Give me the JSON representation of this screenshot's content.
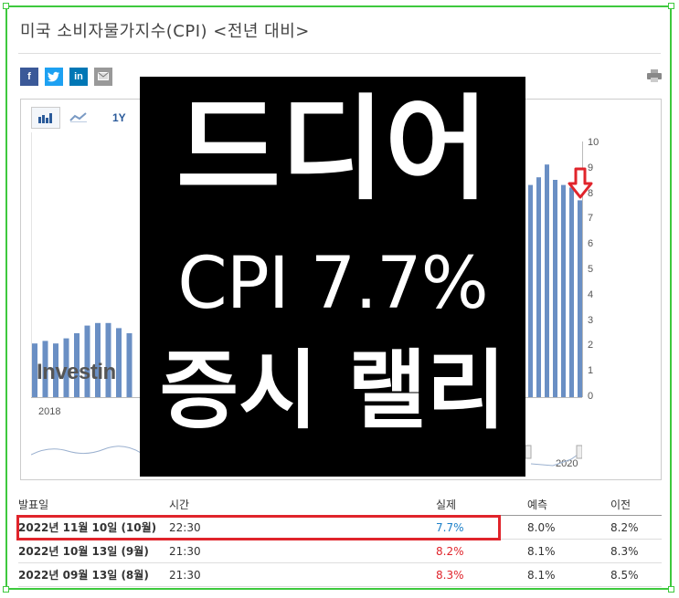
{
  "title": "미국 소비자물가지수(CPI) <전년 대비>",
  "share_buttons": [
    {
      "label": "f",
      "color": "#3b5998",
      "icon": "facebook-icon"
    },
    {
      "label": "t",
      "color": "#1da1f2",
      "icon": "twitter-icon"
    },
    {
      "label": "in",
      "color": "#0077b5",
      "icon": "linkedin-icon"
    },
    {
      "label": "",
      "color": "#999999",
      "icon": "email-icon"
    }
  ],
  "toolbar": {
    "period_label": "1Y"
  },
  "overlay": {
    "line1": "드디어",
    "line2": "CPI 7.7%",
    "line3": "증시 랠리"
  },
  "chart": {
    "watermark": "Investin",
    "x_label_start": "2018",
    "x_label_end": "2020",
    "y_ticks": [
      "10",
      "9",
      "8",
      "7",
      "6",
      "5",
      "4",
      "3",
      "2",
      "1",
      "0"
    ],
    "bar_color": "#6a8fc4"
  },
  "chart_data": {
    "type": "bar",
    "ylim": [
      0,
      10
    ],
    "values_left": [
      2.1,
      2.2,
      2.1,
      2.3,
      2.5,
      2.8,
      2.9,
      2.9,
      2.7,
      2.5
    ],
    "values_right": [
      8.3,
      8.6,
      9.1,
      8.5,
      8.3,
      8.2,
      7.7
    ]
  },
  "table": {
    "headers": [
      "발표일",
      "시간",
      "실제",
      "예측",
      "이전"
    ],
    "rows": [
      {
        "date": "2022년 11월 10일 (10월)",
        "time": "22:30",
        "actual": "7.7%",
        "forecast": "8.0%",
        "previous": "8.2%",
        "actual_color": "#1a7fc8"
      },
      {
        "date": "2022년 10월 13일 (9월)",
        "time": "21:30",
        "actual": "8.2%",
        "forecast": "8.1%",
        "previous": "8.3%",
        "actual_color": "#e0242b"
      },
      {
        "date": "2022년 09월 13일 (8월)",
        "time": "21:30",
        "actual": "8.3%",
        "forecast": "8.1%",
        "previous": "8.5%",
        "actual_color": "#e0242b"
      }
    ]
  }
}
